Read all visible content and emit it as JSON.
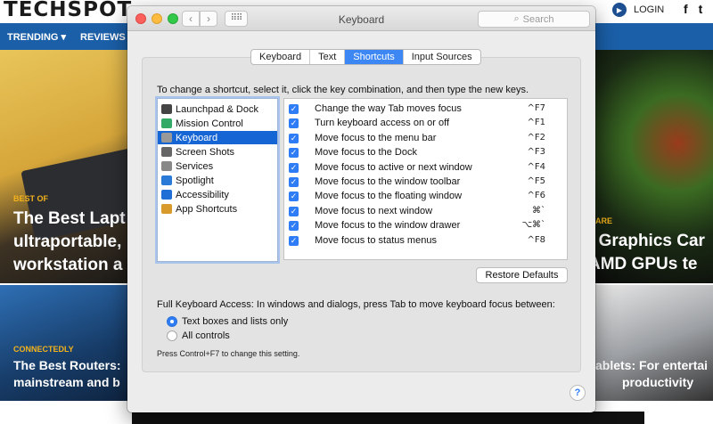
{
  "site": {
    "logo": "TECHSPOT",
    "login": "LOGIN",
    "social": [
      "f",
      "t"
    ],
    "nav": [
      "TRENDING ▾",
      "REVIEWS ▾"
    ],
    "hero_left": {
      "kicker": "BEST OF",
      "title_lines": [
        "The Best Lapt",
        "ultraportable,",
        "workstation a"
      ]
    },
    "hero_right": {
      "kicker": "ARE",
      "title_lines": [
        "t Graphics Car",
        "AMD GPUs te"
      ]
    },
    "tile_left": {
      "kicker": "CONNECTEDLY",
      "title_lines": [
        "The Best Routers:",
        "mainstream and b"
      ]
    },
    "tile_right": {
      "title_lines": [
        "ablets: For entertai",
        "productivity"
      ]
    }
  },
  "window": {
    "title": "Keyboard",
    "search_placeholder": "Search",
    "tabs": [
      {
        "label": "Keyboard",
        "active": false
      },
      {
        "label": "Text",
        "active": false
      },
      {
        "label": "Shortcuts",
        "active": true
      },
      {
        "label": "Input Sources",
        "active": false
      }
    ],
    "instructions": "To change a shortcut, select it, click the key combination, and then type the new keys.",
    "categories": [
      {
        "label": "Launchpad & Dock",
        "icon": "launchpad-icon",
        "color": "#444",
        "selected": false
      },
      {
        "label": "Mission Control",
        "icon": "mission-control-icon",
        "color": "#3a6",
        "selected": false
      },
      {
        "label": "Keyboard",
        "icon": "keyboard-icon",
        "color": "#999",
        "selected": true
      },
      {
        "label": "Screen Shots",
        "icon": "screenshot-icon",
        "color": "#666",
        "selected": false
      },
      {
        "label": "Services",
        "icon": "gear-icon",
        "color": "#888",
        "selected": false
      },
      {
        "label": "Spotlight",
        "icon": "spotlight-icon",
        "color": "#2a7ad8",
        "selected": false
      },
      {
        "label": "Accessibility",
        "icon": "accessibility-icon",
        "color": "#1f6fd6",
        "selected": false
      },
      {
        "label": "App Shortcuts",
        "icon": "app-shortcuts-icon",
        "color": "#d89a2a",
        "selected": false
      }
    ],
    "shortcuts": [
      {
        "label": "Change the way Tab moves focus",
        "key": "^F7",
        "checked": true
      },
      {
        "label": "Turn keyboard access on or off",
        "key": "^F1",
        "checked": true
      },
      {
        "label": "Move focus to the menu bar",
        "key": "^F2",
        "checked": true
      },
      {
        "label": "Move focus to the Dock",
        "key": "^F3",
        "checked": true
      },
      {
        "label": "Move focus to active or next window",
        "key": "^F4",
        "checked": true
      },
      {
        "label": "Move focus to the window toolbar",
        "key": "^F5",
        "checked": true
      },
      {
        "label": "Move focus to the floating window",
        "key": "^F6",
        "checked": true
      },
      {
        "label": "Move focus to next window",
        "key": "⌘`",
        "checked": true
      },
      {
        "label": "Move focus to the window drawer",
        "key": "⌥⌘`",
        "checked": true
      },
      {
        "label": "Move focus to status menus",
        "key": "^F8",
        "checked": true
      }
    ],
    "restore_defaults": "Restore Defaults",
    "full_keyboard_access": "Full Keyboard Access: In windows and dialogs, press Tab to move keyboard focus between:",
    "radio_options": [
      {
        "label": "Text boxes and lists only",
        "selected": true
      },
      {
        "label": "All controls",
        "selected": false
      }
    ],
    "hint": "Press Control+F7 to change this setting.",
    "help": "?"
  }
}
